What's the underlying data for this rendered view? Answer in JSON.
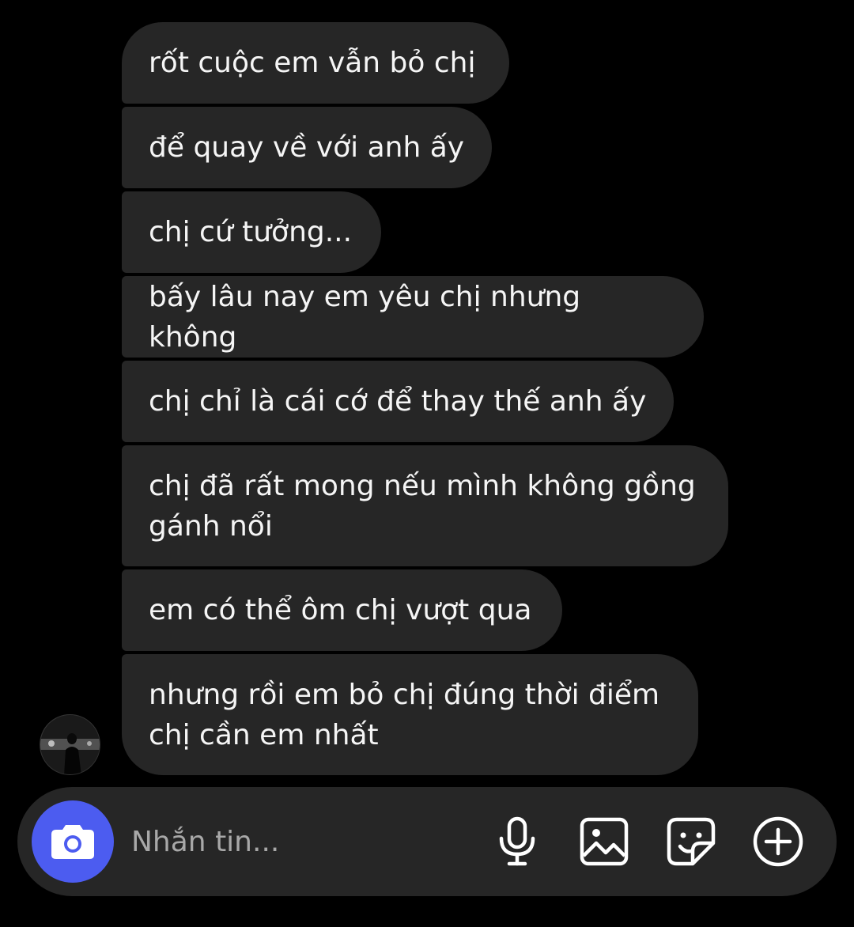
{
  "thread": {
    "messages": [
      {
        "text": "rốt cuộc em vẫn bỏ chị"
      },
      {
        "text": "để quay về với anh ấy"
      },
      {
        "text": "chị cứ tưởng..."
      },
      {
        "text": "bấy lâu nay em yêu chị nhưng không"
      },
      {
        "text": "chị chỉ là cái cớ để thay thế anh ấy"
      },
      {
        "text": "chị đã rất mong nếu mình không gồng\ngánh nổi"
      },
      {
        "text": "em có thể ôm chị vượt qua"
      },
      {
        "text": "nhưng rồi em bỏ chị đúng thời điểm\nchị cần em nhất"
      }
    ]
  },
  "composer": {
    "placeholder": "Nhắn tin...",
    "value": "",
    "icons": [
      "camera-icon",
      "microphone-icon",
      "gallery-icon",
      "sticker-icon",
      "plus-circle-icon"
    ]
  },
  "colors": {
    "background": "#000000",
    "bubble": "#262626",
    "composer": "#262626",
    "camera_button": "#4c5cf0",
    "placeholder": "#a8a8a8",
    "text": "#f5f5f5"
  }
}
